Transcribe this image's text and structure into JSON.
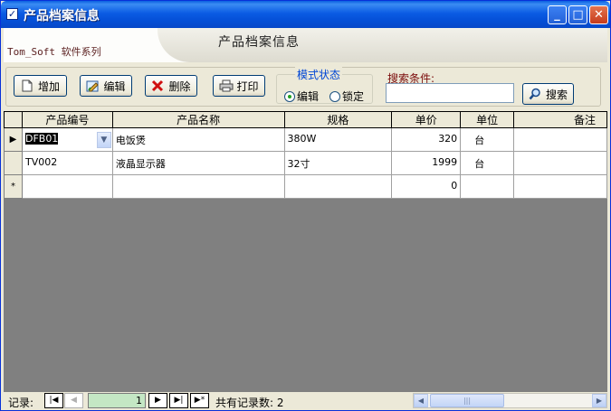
{
  "window": {
    "title": "产品档案信息",
    "controls": {
      "minimize": "_",
      "maximize": "□",
      "close": "✕"
    }
  },
  "header": {
    "brand": "Tom_Soft 软件系列",
    "form_title": "产品档案信息"
  },
  "toolbar": {
    "add_label": "增加",
    "edit_label": "编辑",
    "delete_label": "删除",
    "print_label": "打印",
    "mode": {
      "legend": "模式状态",
      "options": [
        {
          "label": "编辑",
          "selected": true
        },
        {
          "label": "锁定",
          "selected": false
        }
      ]
    },
    "search": {
      "label": "搜索条件:",
      "value": "",
      "button_label": "搜索"
    }
  },
  "grid": {
    "columns": [
      "产品编号",
      "产品名称",
      "规格",
      "单价",
      "单位",
      "备注"
    ],
    "rows": [
      {
        "selector": "▶",
        "code": "DFB01",
        "name": "电饭煲",
        "spec": "380W",
        "price": "320",
        "unit": "台",
        "note": ""
      },
      {
        "selector": "",
        "code": "TV002",
        "name": "液晶显示器",
        "spec": "32寸",
        "price": "1999",
        "unit": "台",
        "note": ""
      }
    ],
    "new_row": {
      "selector": "*",
      "price": "0"
    }
  },
  "navigator": {
    "label": "记录:",
    "current_record": "1",
    "total_text": "共有记录数: 2",
    "buttons": {
      "first": "|◀",
      "prev": "◀",
      "next": "▶",
      "last": "▶|",
      "new": "▶*"
    }
  },
  "colors": {
    "titlebar": "#0550d8",
    "dialog_face": "#ece9d8",
    "grid_background": "#808080",
    "mode_legend": "#0046d5",
    "search_label": "#7a0a0a"
  }
}
